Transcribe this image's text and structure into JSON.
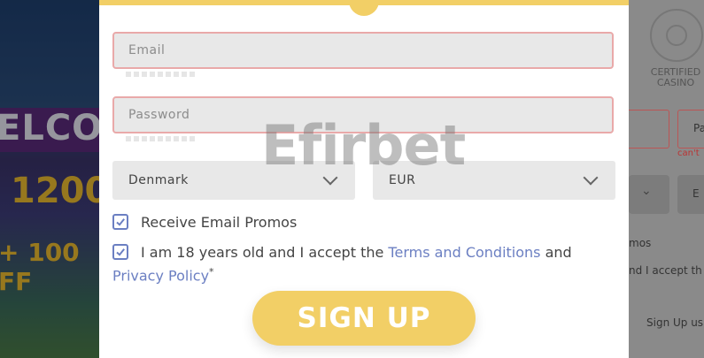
{
  "background_left": {
    "welcome_text": "ELCO",
    "bonus_amount": "1200",
    "free_spins": "+ 100 FF"
  },
  "background_right": {
    "badge_label": "CERTIFIED CASINO",
    "error_text": "can't",
    "password_label": "Pa",
    "currency_label": "E",
    "promos_text": "mos",
    "terms_text": "nd I accept th",
    "signup_text": "Sign Up us"
  },
  "form": {
    "email_placeholder": "Email",
    "password_placeholder": "Password",
    "country": "Denmark",
    "currency": "EUR",
    "promo_checkbox_label": "Receive Email Promos",
    "promo_checked": true,
    "terms_checked": true,
    "terms_prefix": "I am 18 years old and I accept the ",
    "terms_link": "Terms and Conditions",
    "terms_middle": " and ",
    "privacy_link": "Privacy Policy",
    "required_mark": "*",
    "signup_button": "SIGN UP"
  },
  "watermark": "Efirbet",
  "colors": {
    "accent_yellow": "#f2cf66",
    "link_blue": "#6b7fc2",
    "error_border": "#e9a9a9",
    "field_bg": "#e8e8e8"
  }
}
